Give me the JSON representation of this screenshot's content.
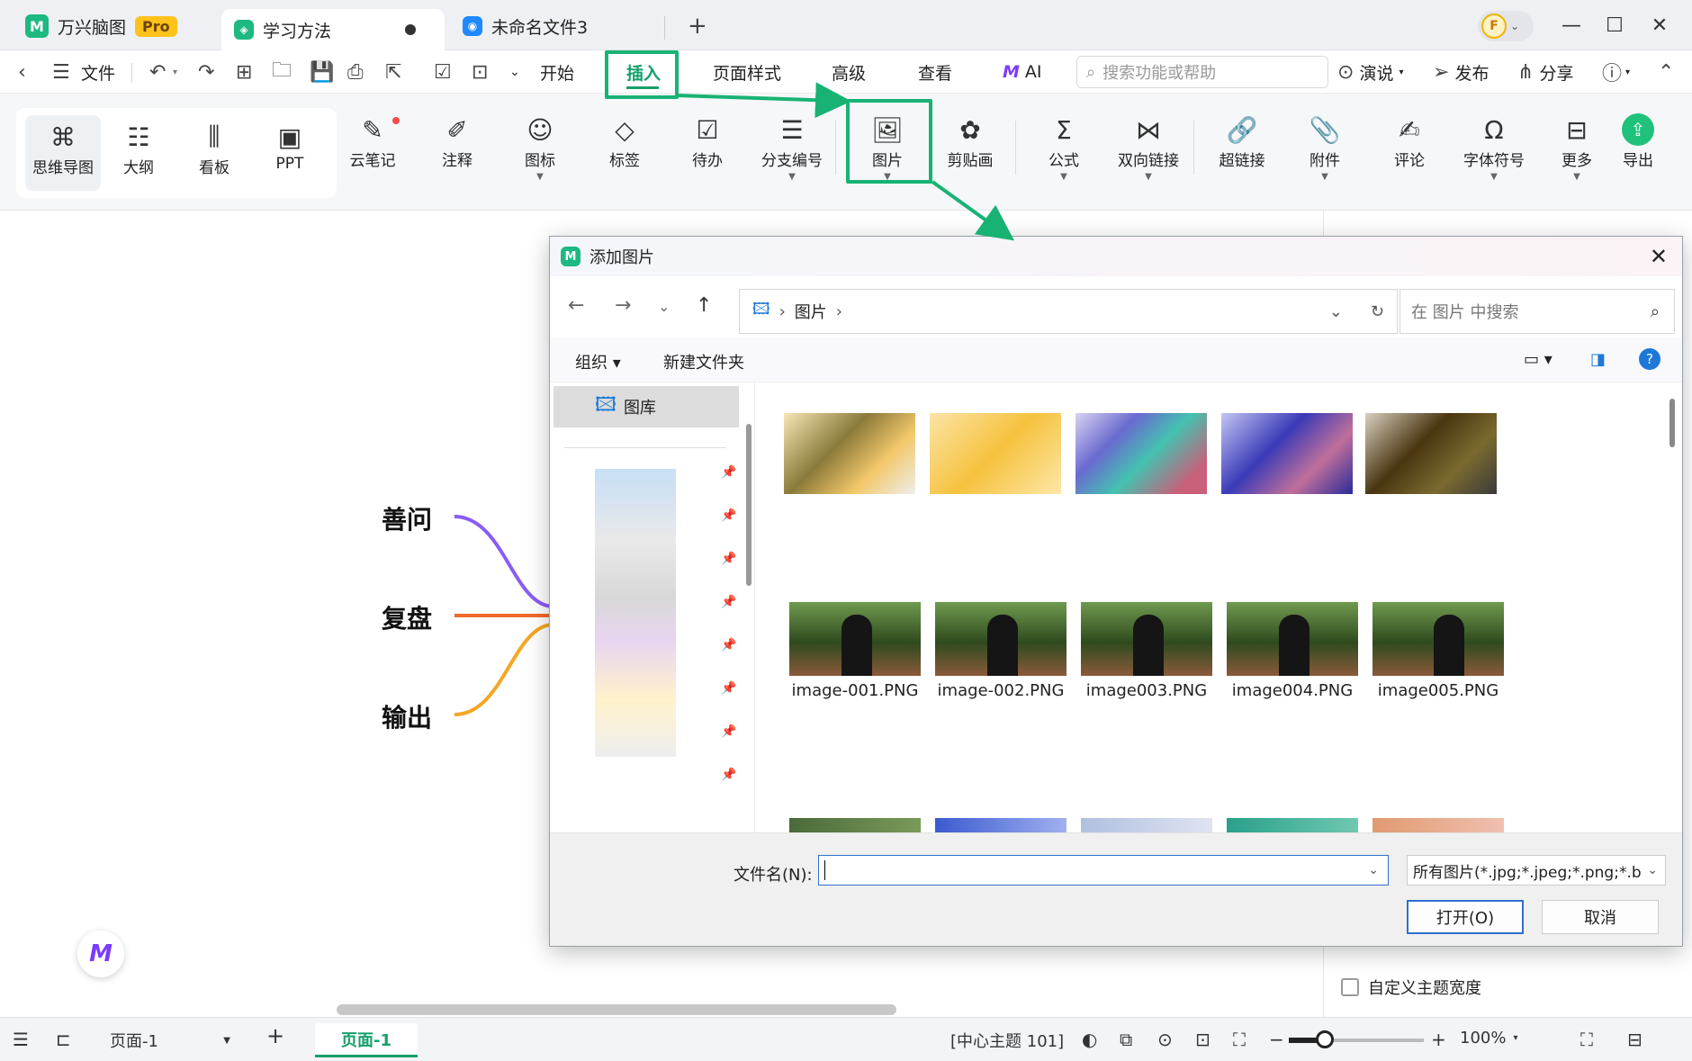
{
  "titlebar": {
    "tabs": [
      {
        "label": "万兴脑图",
        "badge": "Pro"
      },
      {
        "label": "学习方法"
      },
      {
        "label": "未命名文件3"
      }
    ],
    "new_tab": "+",
    "user_initial": "F"
  },
  "menubar": {
    "file": "文件",
    "items": [
      "开始",
      "插入",
      "页面样式",
      "高级",
      "查看",
      "AI"
    ],
    "search_placeholder": "搜索功能或帮助",
    "present": "演说",
    "publish": "发布",
    "share": "分享"
  },
  "toolbar": {
    "views": [
      "思维导图",
      "大纲",
      "看板",
      "PPT"
    ],
    "tools": [
      "云笔记",
      "注释",
      "图标",
      "标签",
      "待办",
      "分支编号",
      "图片",
      "剪贴画",
      "公式",
      "双向链接",
      "超链接",
      "附件",
      "评论",
      "字体符号",
      "更多",
      "导出"
    ]
  },
  "canvas": {
    "nodes": [
      "善问",
      "复盘",
      "输出"
    ],
    "branch_colors": [
      "#8a5cf5",
      "#f06a2a",
      "#f5a623"
    ]
  },
  "right_panel": {
    "checkbox_label": "自定义主题宽度"
  },
  "dialog": {
    "title": "添加图片",
    "breadcrumb": "图片",
    "search_placeholder": "在 图片 中搜索",
    "organize": "组织",
    "new_folder": "新建文件夹",
    "gallery": "图库",
    "files": [
      "image-001.PNG",
      "image-002.PNG",
      "image003.PNG",
      "image004.PNG",
      "image005.PNG"
    ],
    "filename_label": "文件名(N):",
    "filename_value": "",
    "filter": "所有图片(*.jpg;*.jpeg;*.png;*.b",
    "open": "打开(O)",
    "cancel": "取消"
  },
  "statusbar": {
    "page_select": "页面-1",
    "page_tab": "页面-1",
    "selection": "[中心主题 101]",
    "zoom": "100%"
  },
  "colors": {
    "accent": "#16a06a",
    "highlight": "#18b374"
  }
}
